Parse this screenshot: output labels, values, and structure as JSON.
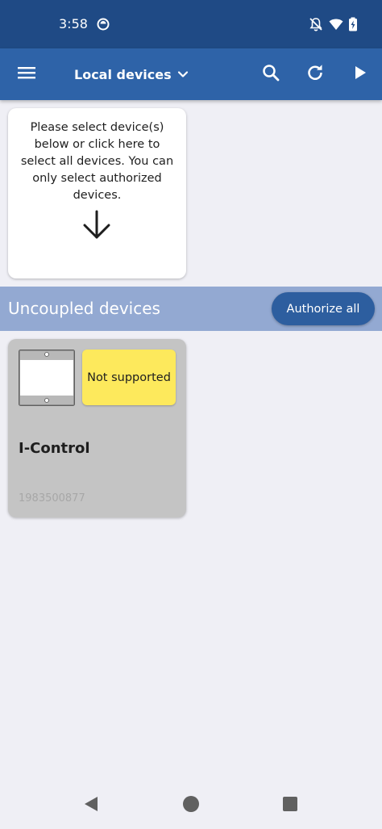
{
  "status_bar": {
    "time": "3:58",
    "icons": [
      "sync-circle-icon",
      "notifications-off-icon",
      "wifi-icon",
      "battery-charging-icon"
    ]
  },
  "app_bar": {
    "title": "Local devices",
    "icons": [
      "menu-icon",
      "chevron-down-icon",
      "search-icon",
      "refresh-icon",
      "play-icon"
    ]
  },
  "select_card": {
    "text": "Please select device(s) below or click here to select all devices. You can only select authorized devices.",
    "icon": "arrow-down-icon"
  },
  "section": {
    "title": "Uncoupled devices",
    "authorize_label": "Authorize all"
  },
  "devices": [
    {
      "name": "I-Control",
      "serial": "1983500877",
      "status": "Not supported",
      "icon": "device-panel-icon"
    }
  ],
  "nav_bar": {
    "icons": [
      "back-icon",
      "home-icon",
      "recents-icon"
    ]
  },
  "colors": {
    "status_bar": "#1f4a85",
    "app_bar": "#2e63a8",
    "section_bar": "#93a9d2",
    "authorize_button": "#2d5e9f",
    "background": "#efeff5",
    "device_card": "#c4c4c4",
    "badge_not_supported": "#fde95c"
  }
}
